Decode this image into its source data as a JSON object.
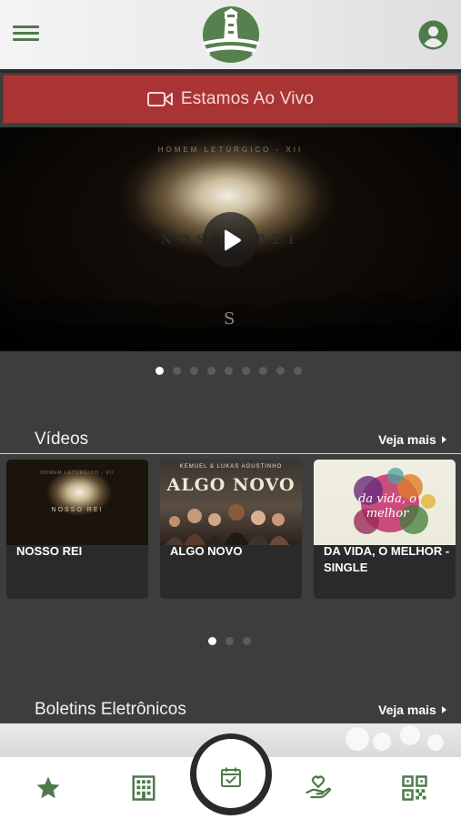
{
  "header": {
    "menu_icon": "hamburger-menu-icon",
    "logo": "lighthouse-logo",
    "account_icon": "account-circle-icon",
    "brand_color": "#4f7a4a"
  },
  "live_banner": {
    "label": "Estamos Ao Vivo",
    "icon": "video-camera-icon",
    "background": "#a93433"
  },
  "hero": {
    "subtitle": "HOMEM LETÚRGICO - XII",
    "title": "NOSSO REI",
    "monogram": "S",
    "play_icon": "play-icon",
    "carousel": {
      "count": 9,
      "active": 0
    }
  },
  "videos": {
    "title": "Vídeos",
    "see_more": "Veja mais",
    "items": [
      {
        "title": "NOSSO REI",
        "thumb_text": "NOSSO REI",
        "thumb_sub": "HOMEM LETÚRGICO - XII"
      },
      {
        "title": "ALGO NOVO",
        "thumb_text": "ALGO NOVO",
        "thumb_sub": "KEMUEL & LUKAS AGUSTINHO"
      },
      {
        "title": "DA VIDA, O MELHOR - SINGLE",
        "thumb_text": "da vida, o melhor",
        "thumb_sub": ""
      }
    ],
    "carousel": {
      "count": 3,
      "active": 0
    }
  },
  "bulletins": {
    "title": "Boletins Eletrônicos",
    "see_more": "Veja mais"
  },
  "tabbar": {
    "items": [
      {
        "icon": "star-icon"
      },
      {
        "icon": "building-icon"
      },
      {
        "icon": "calendar-check-icon"
      },
      {
        "icon": "hand-heart-icon"
      },
      {
        "icon": "qr-code-icon"
      }
    ]
  }
}
